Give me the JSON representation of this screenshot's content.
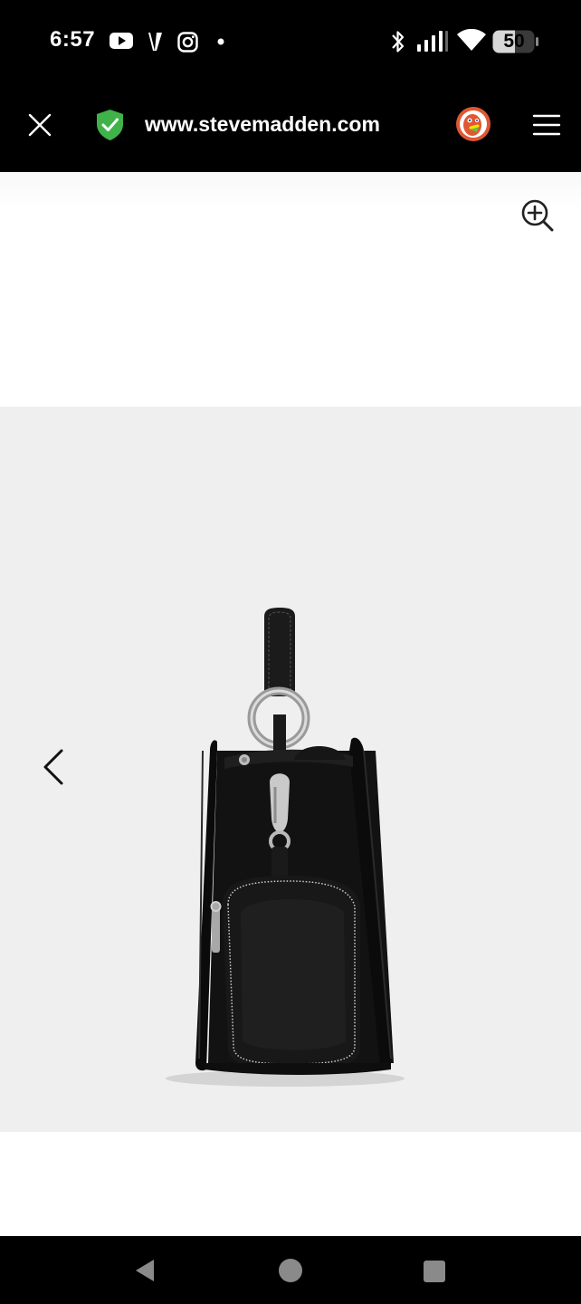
{
  "status_bar": {
    "time": "6:57",
    "battery": "50",
    "app_icons": [
      "youtube-icon",
      "v-app-icon",
      "instagram-icon",
      "dot-icon"
    ],
    "system_icons": [
      "bluetooth-icon",
      "signal-icon",
      "wifi-icon",
      "battery-icon"
    ]
  },
  "browser": {
    "url": "www.stevemadden.com",
    "close_icon": "close-icon",
    "security_icon": "shield-check-icon",
    "browser_icon": "duckduckgo-icon",
    "menu_icon": "menu-icon"
  },
  "product_gallery": {
    "zoom_icon": "zoom-in-icon",
    "prev_icon": "chevron-left-icon",
    "image_subject": "black handbag with pouch side view"
  },
  "nav_bar": {
    "buttons": [
      "back-icon",
      "home-icon",
      "recents-icon"
    ]
  },
  "colors": {
    "status_bg": "#000000",
    "gallery_bg": "#efefef",
    "shield_green": "#3fb34a",
    "duck_orange": "#de5833"
  }
}
